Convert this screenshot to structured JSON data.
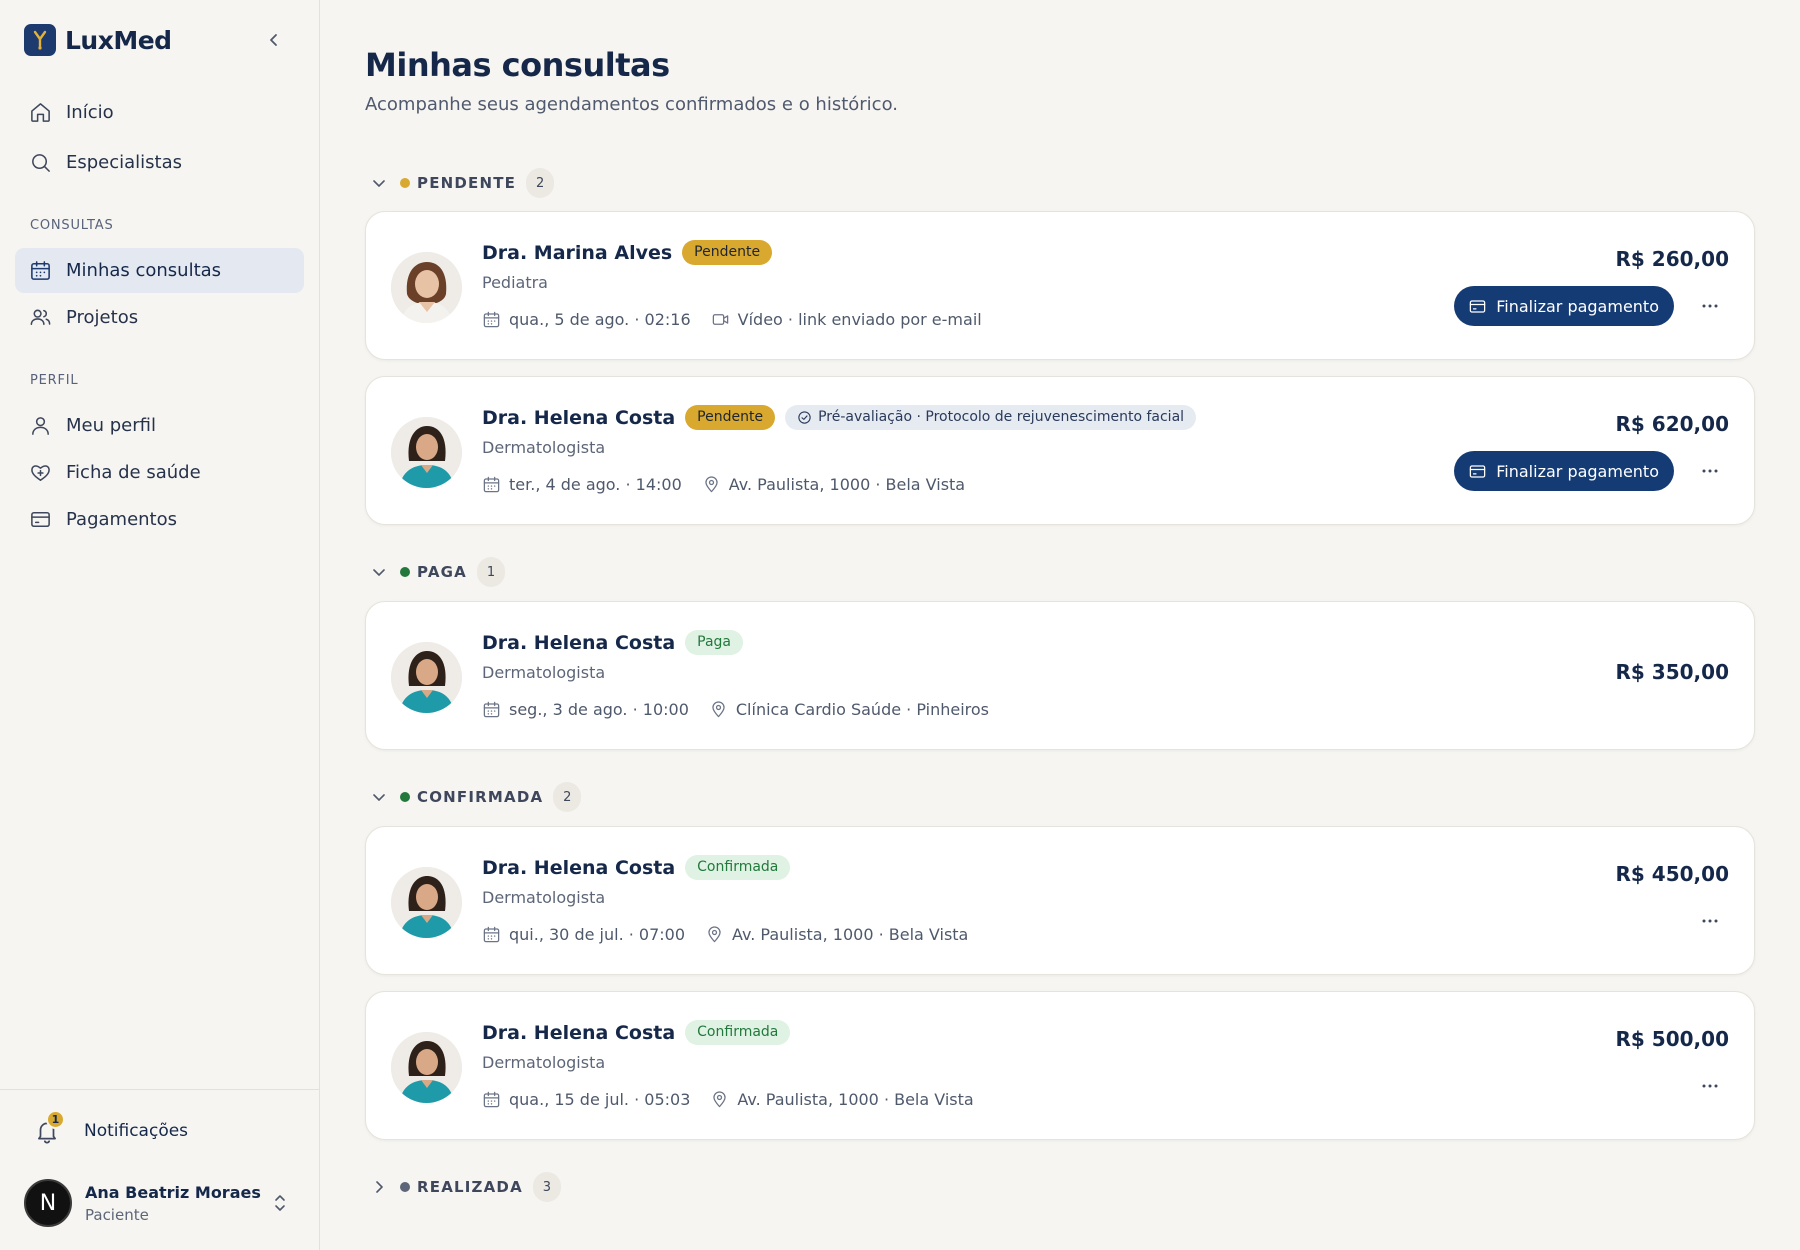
{
  "brand": {
    "name": "LuxMed"
  },
  "nav": {
    "top": [
      {
        "label": "Início",
        "icon": "home-icon"
      },
      {
        "label": "Especialistas",
        "icon": "search-icon"
      }
    ],
    "sections": [
      {
        "title": "CONSULTAS",
        "items": [
          {
            "label": "Minhas consultas",
            "icon": "calendar-icon",
            "active": true
          },
          {
            "label": "Projetos",
            "icon": "users-icon"
          }
        ]
      },
      {
        "title": "PERFIL",
        "items": [
          {
            "label": "Meu perfil",
            "icon": "user-icon"
          },
          {
            "label": "Ficha de saúde",
            "icon": "heart-plus-icon"
          },
          {
            "label": "Pagamentos",
            "icon": "credit-card-icon"
          }
        ]
      }
    ]
  },
  "footer": {
    "notifications_label": "Notificações",
    "notifications_count": "1",
    "user_initial": "N",
    "user_name": "Ana Beatriz Moraes",
    "user_role": "Paciente"
  },
  "page": {
    "title": "Minhas consultas",
    "subtitle": "Acompanhe seus agendamentos confirmados e o histórico."
  },
  "groups": [
    {
      "label": "PENDENTE",
      "count": "2",
      "dot_color": "#d9a92f"
    },
    {
      "label": "PAGA",
      "count": "1",
      "dot_color": "#23793c"
    },
    {
      "label": "CONFIRMADA",
      "count": "2",
      "dot_color": "#23793c"
    },
    {
      "label": "REALIZADA",
      "count": "3",
      "dot_color": "#5d6678"
    }
  ],
  "cards": [
    {
      "name": "Dra. Marina Alves",
      "status": "Pendente",
      "specialty": "Pediatra",
      "date": "qua., 5 de ago. · 02:16",
      "location": "Vídeo · link enviado por e-mail",
      "location_icon": "video-icon",
      "price": "R$ 260,00",
      "action": "Finalizar pagamento"
    },
    {
      "name": "Dra. Helena Costa",
      "status": "Pendente",
      "extra_badge": "Pré-avaliação · Protocolo de rejuvenescimento facial",
      "specialty": "Dermatologista",
      "date": "ter., 4 de ago. · 14:00",
      "location": "Av. Paulista, 1000 · Bela Vista",
      "location_icon": "map-pin-icon",
      "price": "R$ 620,00",
      "action": "Finalizar pagamento"
    },
    {
      "name": "Dra. Helena Costa",
      "status": "Paga",
      "specialty": "Dermatologista",
      "date": "seg., 3 de ago. · 10:00",
      "location": "Clínica Cardio Saúde · Pinheiros",
      "location_icon": "map-pin-icon",
      "price": "R$ 350,00"
    },
    {
      "name": "Dra. Helena Costa",
      "status": "Confirmada",
      "specialty": "Dermatologista",
      "date": "qui., 30 de jul. · 07:00",
      "location": "Av. Paulista, 1000 · Bela Vista",
      "location_icon": "map-pin-icon",
      "price": "R$ 450,00"
    },
    {
      "name": "Dra. Helena Costa",
      "status": "Confirmada",
      "specialty": "Dermatologista",
      "date": "qua., 15 de jul. · 05:03",
      "location": "Av. Paulista, 1000 · Bela Vista",
      "location_icon": "map-pin-icon",
      "price": "R$ 500,00"
    }
  ]
}
